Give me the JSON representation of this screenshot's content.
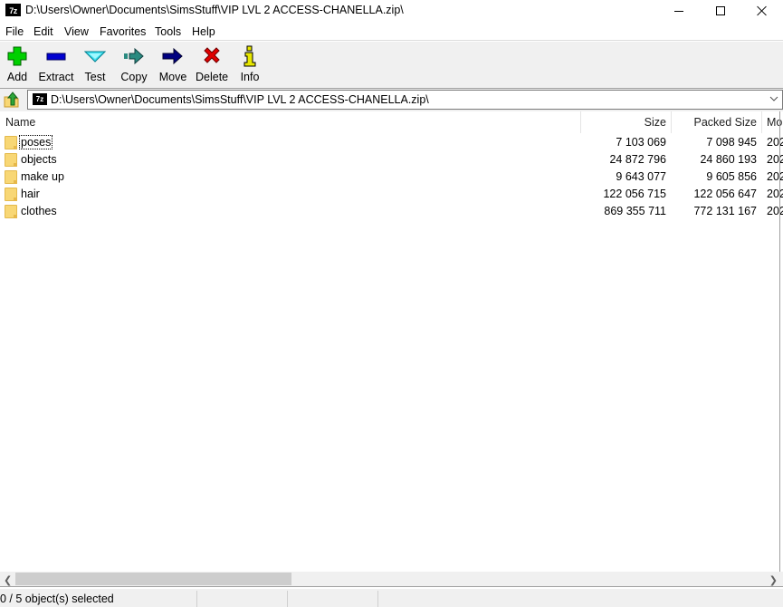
{
  "window": {
    "app_icon": "7z",
    "title": "D:\\Users\\Owner\\Documents\\SimsStuff\\VIP LVL 2 ACCESS-CHANELLA.zip\\"
  },
  "menu": [
    "File",
    "Edit",
    "View",
    "Favorites",
    "Tools",
    "Help"
  ],
  "toolbar": {
    "buttons": [
      {
        "label": "Add",
        "icon": "plus-icon",
        "color": "#00d000"
      },
      {
        "label": "Extract",
        "icon": "minus-icon",
        "color": "#0000d0"
      },
      {
        "label": "Test",
        "icon": "check-chevron-icon",
        "color": "#40e0f0"
      },
      {
        "label": "Copy",
        "icon": "copy-arrow-icon",
        "color": "#2a8a80"
      },
      {
        "label": "Move",
        "icon": "move-arrow-icon",
        "color": "#000080"
      },
      {
        "label": "Delete",
        "icon": "delete-x-icon",
        "color": "#e00000"
      },
      {
        "label": "Info",
        "icon": "info-icon",
        "color": "#e8e800"
      }
    ]
  },
  "address": {
    "path": "D:\\Users\\Owner\\Documents\\SimsStuff\\VIP LVL 2 ACCESS-CHANELLA.zip\\"
  },
  "columns": {
    "name": "Name",
    "size": "Size",
    "packed": "Packed Size",
    "modified": "Mo"
  },
  "rows": [
    {
      "name": "poses",
      "size": "7 103 069",
      "packed": "7 098 945",
      "modified": "202"
    },
    {
      "name": "objects",
      "size": "24 872 796",
      "packed": "24 860 193",
      "modified": "202"
    },
    {
      "name": "make up",
      "size": "9 643 077",
      "packed": "9 605 856",
      "modified": "202"
    },
    {
      "name": "hair",
      "size": "122 056 715",
      "packed": "122 056 647",
      "modified": "202"
    },
    {
      "name": "clothes",
      "size": "869 355 711",
      "packed": "772 131 167",
      "modified": "202"
    }
  ],
  "status": {
    "selection": "0 / 5 object(s) selected"
  }
}
